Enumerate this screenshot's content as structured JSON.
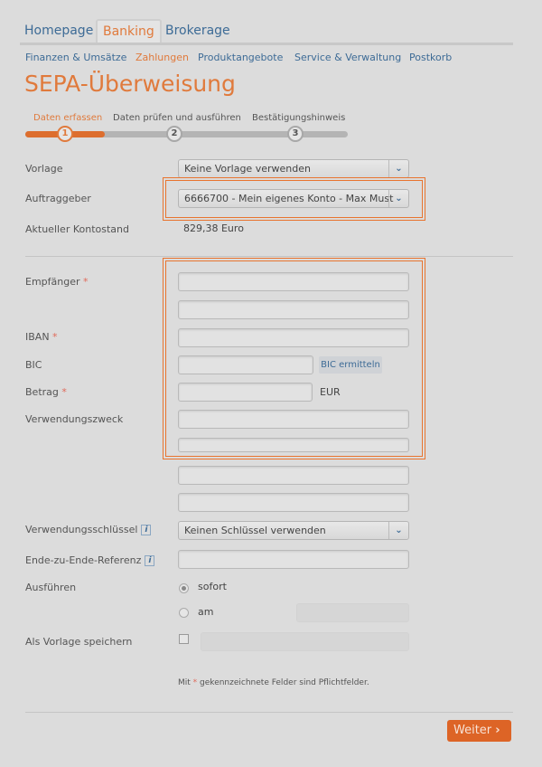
{
  "tabs": [
    "Homepage",
    "Banking",
    "Brokerage"
  ],
  "subnav": [
    "Finanzen & Umsätze",
    "Zahlungen",
    "Produktangebote",
    "Service & Verwaltung",
    "Postkorb"
  ],
  "title": "SEPA-Überweisung",
  "steps": [
    {
      "label": "Daten erfassen",
      "num": "1"
    },
    {
      "label": "Daten prüfen und ausführen",
      "num": "2"
    },
    {
      "label": "Bestätigungshinweis",
      "num": "3"
    }
  ],
  "form": {
    "vorlage_label": "Vorlage",
    "vorlage_value": "Keine Vorlage verwenden",
    "auftraggeber_label": "Auftraggeber",
    "auftraggeber_value": "6666700 - Mein eigenes Konto - Max Must",
    "kontostand_label": "Aktueller Kontostand",
    "kontostand_value": "829,38 Euro",
    "empfaenger_label": "Empfänger",
    "iban_label": "IBAN",
    "bic_label": "BIC",
    "bic_button": "BIC ermitteln",
    "betrag_label": "Betrag",
    "currency": "EUR",
    "zweck_label": "Verwendungszweck",
    "schluessel_label": "Verwendungsschlüssel",
    "schluessel_value": "Keinen Schlüssel verwenden",
    "referenz_label": "Ende-zu-Ende-Referenz",
    "ausfuehren_label": "Ausführen",
    "sofort": "sofort",
    "am": "am",
    "vorlage_speichern_label": "Als Vorlage speichern",
    "required_mark": "*",
    "info": "i",
    "note_pre": "Mit",
    "note_post": "gekennzeichnete Felder sind Pflichtfelder."
  },
  "weiter": "Weiter",
  "colors": {
    "accent": "#e07a3c",
    "link": "#3d6b96",
    "highlight": "#e8742f"
  }
}
